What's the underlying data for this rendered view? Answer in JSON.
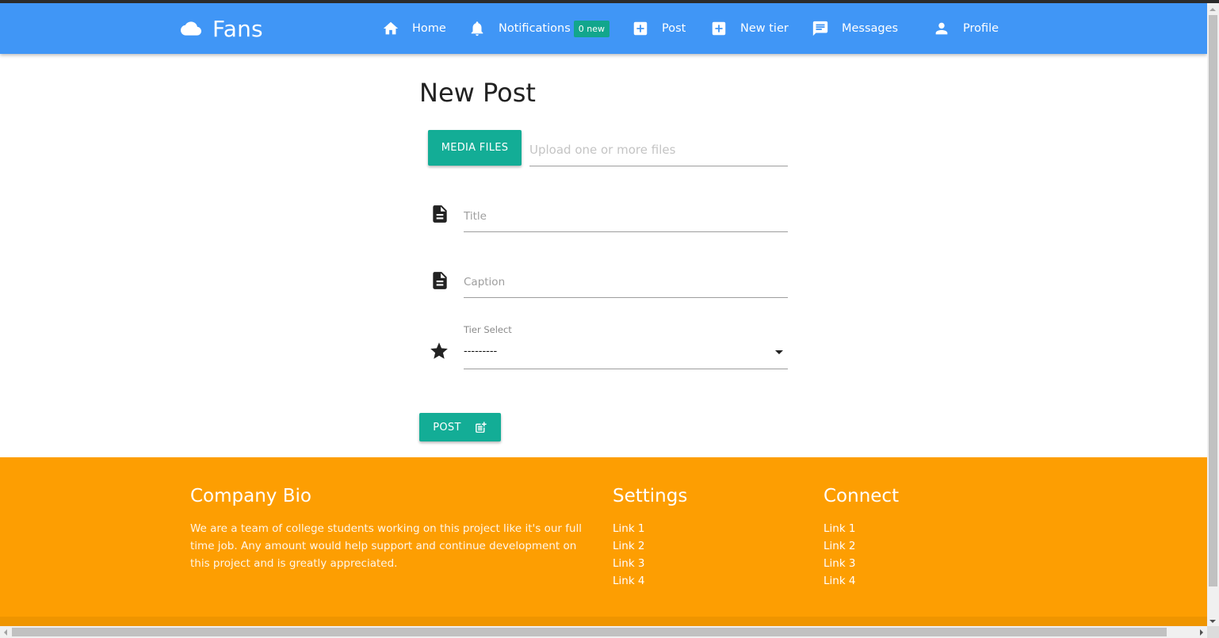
{
  "navbar": {
    "brand": "Fans",
    "brand_icon": "cloud-icon",
    "items": [
      {
        "label": "Home",
        "icon": "home-icon"
      },
      {
        "label": "Notifications",
        "icon": "bell-icon",
        "badge": "0 new"
      },
      {
        "label": "Post",
        "icon": "add-box-icon"
      },
      {
        "label": "New tier",
        "icon": "add-box-icon"
      },
      {
        "label": "Messages",
        "icon": "message-icon"
      },
      {
        "label": "Profile",
        "icon": "person-icon"
      }
    ]
  },
  "main": {
    "title": "New Post",
    "media_button": "MEDIA FILES",
    "upload_placeholder": "Upload one or more files",
    "title_placeholder": "Title",
    "caption_placeholder": "Caption",
    "tier_select": {
      "label": "Tier Select",
      "selected": "---------"
    },
    "post_button": "POST"
  },
  "footer": {
    "bio": {
      "heading": "Company Bio",
      "text": "We are a team of college students working on this project like it's our full time job. Any amount would help support and continue development on this project and is greatly appreciated."
    },
    "settings": {
      "heading": "Settings",
      "links": [
        "Link 1",
        "Link 2",
        "Link 3",
        "Link 4"
      ]
    },
    "connect": {
      "heading": "Connect",
      "links": [
        "Link 1",
        "Link 2",
        "Link 3",
        "Link 4"
      ]
    }
  },
  "colors": {
    "navbar": "#4096f6",
    "accent": "#13ad96",
    "footer": "#fd9e02"
  }
}
